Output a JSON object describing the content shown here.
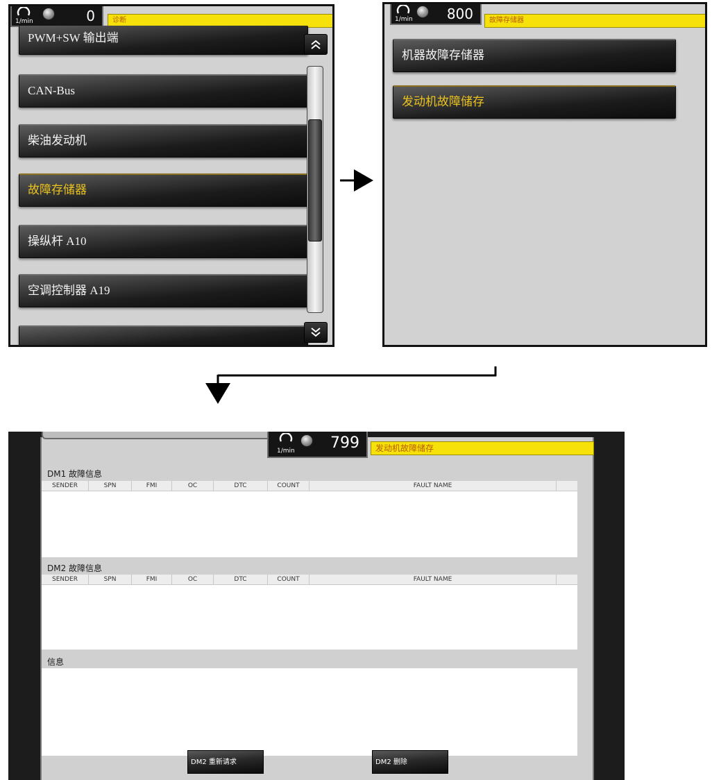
{
  "screen1": {
    "rpm_unit": "1/min",
    "rpm_value": "0",
    "title": "诊断",
    "menu_items": [
      {
        "label": "PWM+SW 输出端",
        "selected": false
      },
      {
        "label": "CAN-Bus",
        "selected": false
      },
      {
        "label": "柴油发动机",
        "selected": false
      },
      {
        "label": "故障存储器",
        "selected": true
      },
      {
        "label": "操纵杆 A10",
        "selected": false
      },
      {
        "label": "空调控制器 A19",
        "selected": false
      },
      {
        "label": "",
        "selected": false
      }
    ],
    "scroll_up_icon": "double-chevron-up-icon",
    "scroll_down_icon": "double-chevron-down-icon"
  },
  "screen2": {
    "rpm_unit": "1/min",
    "rpm_value": "800",
    "title": "故障存储器",
    "menu_items": [
      {
        "label": "机器故障存储器",
        "selected": false
      },
      {
        "label": "发动机故障储存",
        "selected": true
      }
    ]
  },
  "screen3": {
    "rpm_unit": "1/min",
    "rpm_value": "799",
    "title": "发动机故障储存",
    "dm1_label": "DM1 故障信息",
    "dm2_label": "DM2 故障信息",
    "info_label": "信息",
    "columns": [
      "SENDER",
      "SPN",
      "FMI",
      "OC",
      "DTC",
      "COUNT",
      "FAULT NAME"
    ],
    "dm1_rows": [],
    "dm2_rows": [],
    "buttons": {
      "rerequest": "DM2 重新请求",
      "delete": "DM2 删除"
    }
  },
  "colors": {
    "title_strip": "#f6e20a",
    "selected_text": "#e9c21e",
    "panel_bg": "#d2d2d2"
  }
}
